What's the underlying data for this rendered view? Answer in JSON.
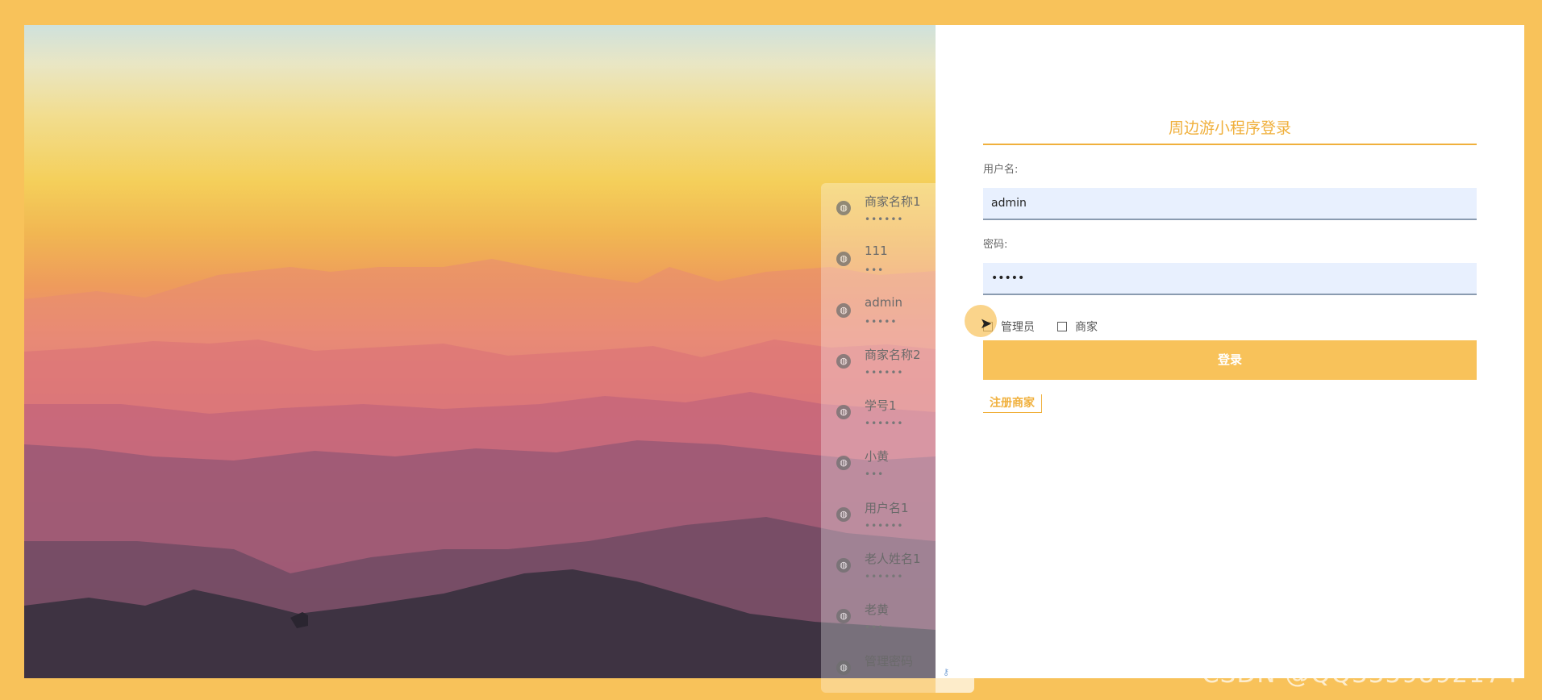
{
  "login": {
    "title": "周边游小程序登录",
    "username_label": "用户名:",
    "username_value": "admin",
    "password_label": "密码:",
    "password_value": "•••••",
    "roles": [
      {
        "label": "管理员",
        "checked": false
      },
      {
        "label": "商家",
        "checked": false
      }
    ],
    "submit_label": "登录",
    "register_label": "注册商家"
  },
  "autofill": {
    "items": [
      {
        "name": "商家名称1",
        "password": "••••••"
      },
      {
        "name": "111",
        "password": "•••"
      },
      {
        "name": "admin",
        "password": "•••••"
      },
      {
        "name": "商家名称2",
        "password": "••••••"
      },
      {
        "name": "学号1",
        "password": "••••••"
      },
      {
        "name": "小黄",
        "password": "•••"
      },
      {
        "name": "用户名1",
        "password": "••••••"
      },
      {
        "name": "老人姓名1",
        "password": "••••••"
      },
      {
        "name": "老黄",
        "password": "•••"
      },
      {
        "name": "管理密码",
        "password": ""
      }
    ],
    "item_icon": "globe-icon",
    "footer_icon": "key-icon"
  },
  "watermark": "CSDN @QQ3359892174",
  "colors": {
    "accent": "#f8c25a",
    "title": "#f0b03c",
    "input_bg": "#e8f0fe"
  }
}
